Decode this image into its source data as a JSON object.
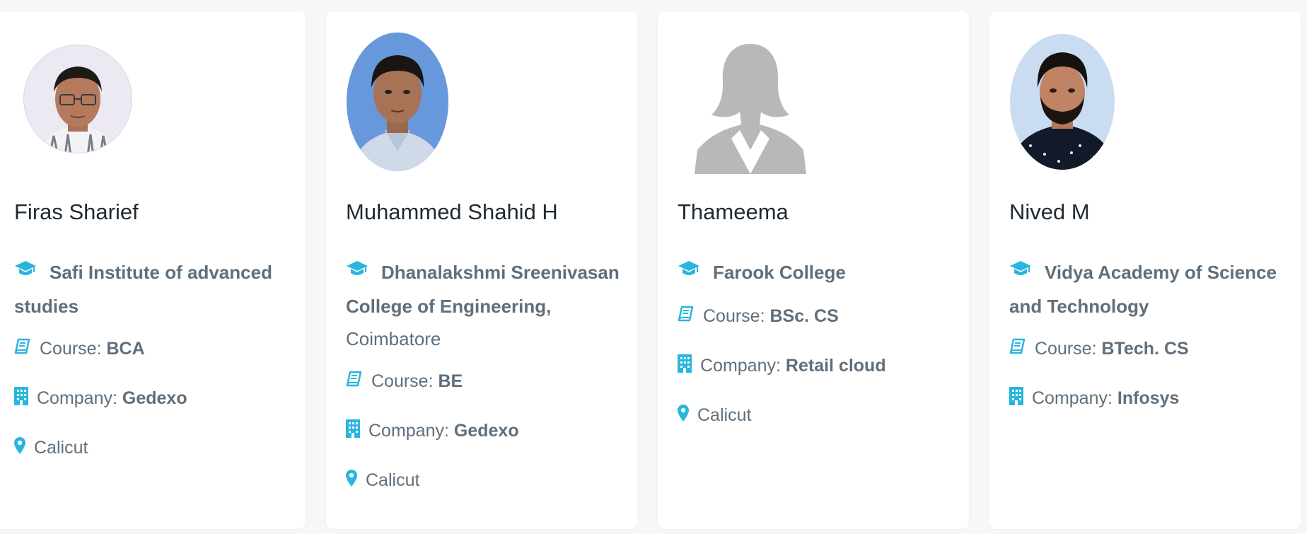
{
  "labels": {
    "course": "Course: ",
    "company": "Company: "
  },
  "colors": {
    "accent": "#29b6de",
    "text": "#5f6f7c",
    "name": "#1f2a33",
    "placeholder": "#b8b8b8"
  },
  "students": [
    {
      "name": "Firas Sharief",
      "institution": "Safi Institute of advanced studies",
      "institution_suffix": "",
      "course": "BCA",
      "company": "Gedexo",
      "location": "Calicut",
      "photo": "photo of young man with glasses"
    },
    {
      "name": "Muhammed Shahid H",
      "institution": "Dhanalakshmi Sreenivasan College of Engineering,",
      "institution_suffix": "Coimbatore",
      "course": "BE",
      "company": "Gedexo",
      "location": "Calicut",
      "photo": "passport photo of young man"
    },
    {
      "name": "Thameema",
      "institution": "Farook College",
      "institution_suffix": "",
      "course": "BSc. CS",
      "company": "Retail cloud",
      "location": "Calicut",
      "photo": "female placeholder silhouette"
    },
    {
      "name": "Nived M",
      "institution": "Vidya Academy of Science and Technology",
      "institution_suffix": "",
      "course": "BTech. CS",
      "company": "Infosys",
      "location": "Calicut",
      "photo": "photo of bearded young man"
    }
  ]
}
